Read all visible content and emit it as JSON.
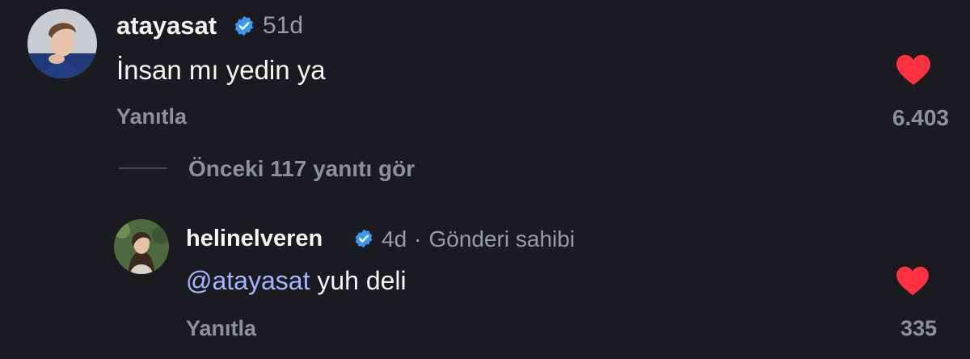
{
  "colors": {
    "background": "#1a1b1f",
    "primary_text": "#f5f5f5",
    "secondary_text": "#8e9097",
    "verified_badge": "#3897f0",
    "like_heart": "#ff3040",
    "mention": "#a5b4ff"
  },
  "comments": [
    {
      "username": "atayasat",
      "verified": true,
      "time": "51d",
      "text": "İnsan mı yedin ya",
      "reply_label": "Yanıtla",
      "likes": "6.403",
      "liked": true,
      "avatar_icon": "profile-photo"
    }
  ],
  "view_replies_label": "Önceki 117 yanıtı gör",
  "replies": [
    {
      "username": "helinelveren",
      "verified": true,
      "time": "4d",
      "separator": "·",
      "role_label": "Gönderi sahibi",
      "mention": "@atayasat",
      "text": " yuh deli",
      "reply_label": "Yanıtla",
      "likes": "335",
      "liked": true,
      "avatar_icon": "profile-photo"
    }
  ]
}
